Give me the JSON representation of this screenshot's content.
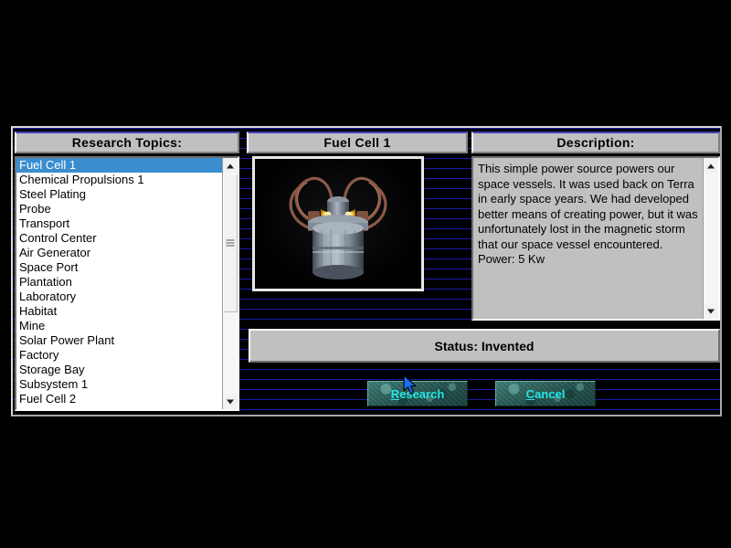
{
  "dialog": {
    "topics_header": "Research Topics:",
    "item_header": "Fuel Cell 1",
    "description_header": "Description:",
    "status_text": "Status: Invented",
    "description_text": "This simple power source powers our space vessels.  It was used back on Terra in early space years. We had developed better means of creating power, but it was unfortunately lost in the magnetic storm that our space vessel encountered.  Power: 5 Kw"
  },
  "topics": [
    {
      "label": "Fuel Cell 1",
      "selected": true
    },
    {
      "label": "Chemical Propulsions 1",
      "selected": false
    },
    {
      "label": "Steel Plating",
      "selected": false
    },
    {
      "label": "Probe",
      "selected": false
    },
    {
      "label": "Transport",
      "selected": false
    },
    {
      "label": "Control Center",
      "selected": false
    },
    {
      "label": "Air Generator",
      "selected": false
    },
    {
      "label": "Space Port",
      "selected": false
    },
    {
      "label": "Plantation",
      "selected": false
    },
    {
      "label": "Laboratory",
      "selected": false
    },
    {
      "label": "Habitat",
      "selected": false
    },
    {
      "label": "Mine",
      "selected": false
    },
    {
      "label": "Solar Power Plant",
      "selected": false
    },
    {
      "label": "Factory",
      "selected": false
    },
    {
      "label": "Storage Bay",
      "selected": false
    },
    {
      "label": "Subsystem 1",
      "selected": false
    },
    {
      "label": "Fuel Cell 2",
      "selected": false
    }
  ],
  "buttons": {
    "research": {
      "accel": "R",
      "rest": "esearch"
    },
    "cancel": {
      "accel": "C",
      "rest": "ancel"
    }
  },
  "preview": {
    "alt": "fuel-cell-render"
  },
  "colors": {
    "background": "#000000",
    "scanline": "#1c1ca8",
    "panel_face": "#c0c0c0",
    "list_background": "#ffffff",
    "selection": "#3a8ed0",
    "button_text": "#25e6e6",
    "button_face": "#2d5e58"
  }
}
